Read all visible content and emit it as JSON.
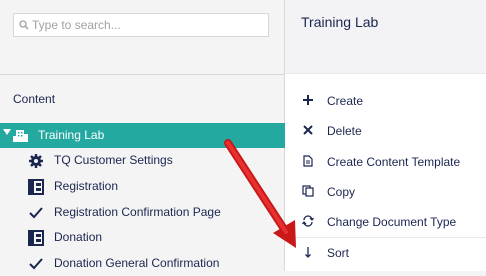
{
  "search": {
    "placeholder": "Type to search..."
  },
  "tree": {
    "header": "Content",
    "root": {
      "label": "Training Lab",
      "icon": "building-icon"
    },
    "items": [
      {
        "label": "TQ Customer Settings",
        "icon": "gear-icon"
      },
      {
        "label": "Registration",
        "icon": "layout-icon"
      },
      {
        "label": "Registration Confirmation Page",
        "icon": "check-icon"
      },
      {
        "label": "Donation",
        "icon": "layout-icon"
      },
      {
        "label": "Donation General Confirmation",
        "icon": "check-icon"
      }
    ]
  },
  "actions_panel": {
    "title": "Training Lab",
    "items": [
      {
        "label": "Create",
        "icon": "plus-icon"
      },
      {
        "label": "Delete",
        "icon": "x-icon"
      },
      {
        "label": "Create Content Template",
        "icon": "document-icon"
      },
      {
        "label": "Copy",
        "icon": "copy-icon"
      },
      {
        "label": "Change Document Type",
        "icon": "swap-icon"
      },
      {
        "label": "Sort",
        "icon": "sort-icon"
      }
    ]
  },
  "colors": {
    "selected_row": "#24a9a1",
    "text": "#1b264f",
    "annotation": "#e02020"
  }
}
